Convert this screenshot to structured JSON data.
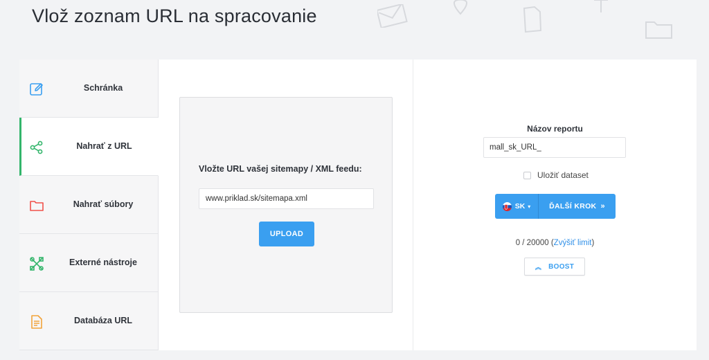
{
  "page": {
    "title": "Vlož zoznam URL na spracovanie"
  },
  "sidebar": {
    "items": [
      {
        "label": "Schránka",
        "icon": "edit-icon",
        "active": false
      },
      {
        "label": "Nahrať z URL",
        "icon": "share-icon",
        "active": true
      },
      {
        "label": "Nahrať súbory",
        "icon": "folder-icon",
        "active": false
      },
      {
        "label": "Externé nástroje",
        "icon": "tools-icon",
        "active": false
      },
      {
        "label": "Databáza URL",
        "icon": "document-icon",
        "active": false
      }
    ]
  },
  "upload": {
    "label": "Vložte URL vašej sitemapy / XML feedu:",
    "input_value": "www.priklad.sk/sitemapa.xml",
    "button_label": "UPLOAD"
  },
  "report": {
    "label": "Názov reportu",
    "input_value": "mall_sk_URL_",
    "save_dataset_label": "Uložiť dataset",
    "language": "SK",
    "next_label": "ĎALŠÍ KROK",
    "limit_prefix": "0 / 20000 (",
    "limit_link": "Zvýšiť limit",
    "limit_suffix": ")",
    "boost_label": "BOOST"
  },
  "colors": {
    "accent": "#3a9ff0",
    "active_border": "#33b56b",
    "background": "#f2f3f5"
  }
}
